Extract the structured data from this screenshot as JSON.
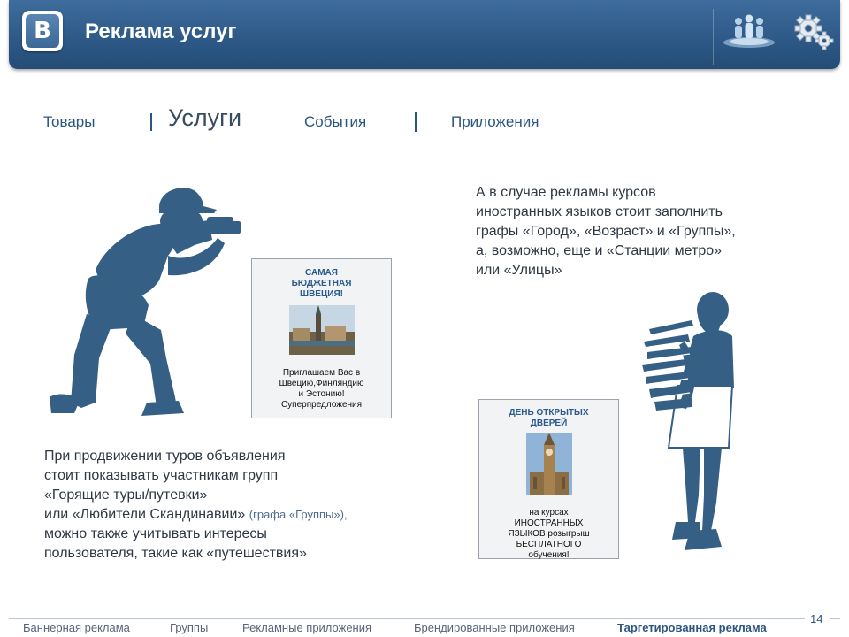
{
  "header": {
    "logo_letter": "B",
    "title": "Реклама услуг"
  },
  "tabs": [
    {
      "label": "Товары",
      "active": false
    },
    {
      "label": "Услуги",
      "active": true
    },
    {
      "label": "События",
      "active": false
    },
    {
      "label": "Приложения",
      "active": false
    }
  ],
  "right_text": [
    "А в случае рекламы курсов",
    "иностранных языков стоит заполнить",
    "графы «Город», «Возраст» и «Группы»,",
    "а, возможно, еще и «Станции метро»",
    "или «Улицы»"
  ],
  "left_text": {
    "line1": "При продвижении туров объявления",
    "line2": "стоит показывать участникам групп",
    "line3": "«Горящие туры/путевки»",
    "line4_main": "или «Любители Скандинавии»",
    "line4_note": "(графа «Группы»),",
    "line5": "можно также учитывать интересы",
    "line6": "пользователя, такие как «путешествия»"
  },
  "ad_sweden": {
    "title_lines": [
      "САМАЯ",
      "БЮДЖЕТНАЯ",
      "ШВЕЦИЯ!"
    ],
    "body_lines": [
      "Приглашаем Вас в",
      "Швецию,Финляндию",
      "и Эстонию!",
      "Суперпредложения"
    ]
  },
  "ad_courses": {
    "title_lines": [
      "ДЕНЬ ОТКРЫТЫХ",
      "ДВЕРЕЙ"
    ],
    "body_lines": [
      "на курсах",
      "ИНОСТРАННЫХ",
      "ЯЗЫКОВ розыгрыш",
      "БЕСПЛАТНОГО",
      "обучения!"
    ]
  },
  "footer": {
    "page_number": "14",
    "links": [
      {
        "label": "Баннерная реклама",
        "active": false
      },
      {
        "label": "Группы",
        "active": false
      },
      {
        "label": "Рекламные приложения",
        "active": false
      },
      {
        "label": "Брендированные приложения",
        "active": false
      },
      {
        "label": "Таргетированная реклама",
        "active": true
      }
    ]
  },
  "colors": {
    "header": "#2e5a88",
    "accent": "#2c5582",
    "silhouette": "#365f86"
  },
  "icons": [
    "vk-logo-icon",
    "people-icon",
    "gear-icon"
  ]
}
